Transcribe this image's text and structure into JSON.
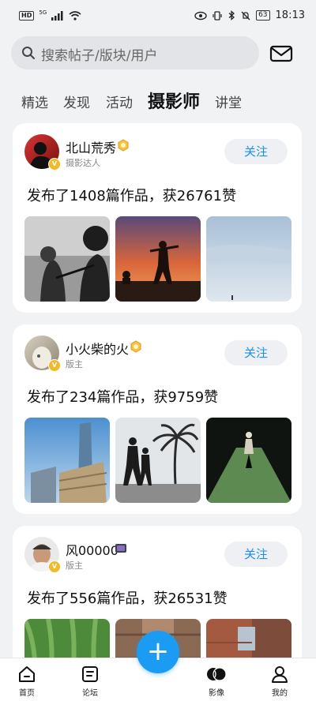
{
  "status": {
    "network": "HD",
    "signal_type": "5G",
    "battery": "63",
    "time": "18:13"
  },
  "search": {
    "placeholder": "搜索帖子/版块/用户",
    "icon": "search-icon",
    "mail_icon": "mail-icon"
  },
  "tabs": [
    {
      "label": "精选",
      "active": false
    },
    {
      "label": "发现",
      "active": false
    },
    {
      "label": "活动",
      "active": false
    },
    {
      "label": "摄影师",
      "active": true
    },
    {
      "label": "讲堂",
      "active": false
    }
  ],
  "cards": [
    {
      "name": "北山荒秀",
      "role": "摄影达人",
      "follow": "关注",
      "stat": "发布了1408篇作品，获26761赞",
      "rank_icon": "gold-badge-icon"
    },
    {
      "name": "小火柴的火",
      "role": "版主",
      "follow": "关注",
      "stat": "发布了234篇作品，获9759赞",
      "rank_icon": "gold-badge-icon"
    },
    {
      "name": "风00000",
      "role": "版主",
      "follow": "关注",
      "stat": "发布了556篇作品，获26531赞",
      "rank_icon": "dark-badge-icon"
    }
  ],
  "nav": [
    {
      "label": "首页",
      "icon": "home-icon"
    },
    {
      "label": "论坛",
      "icon": "forum-icon"
    },
    {
      "label": "影像",
      "icon": "imaging-icon"
    },
    {
      "label": "我的",
      "icon": "profile-icon"
    }
  ],
  "fab_icon": "add-icon",
  "colors": {
    "accent": "#1b9cf2",
    "follow_text": "#1b8ff0",
    "background": "#f1f2f4",
    "badge_gold": "#f2b928"
  }
}
